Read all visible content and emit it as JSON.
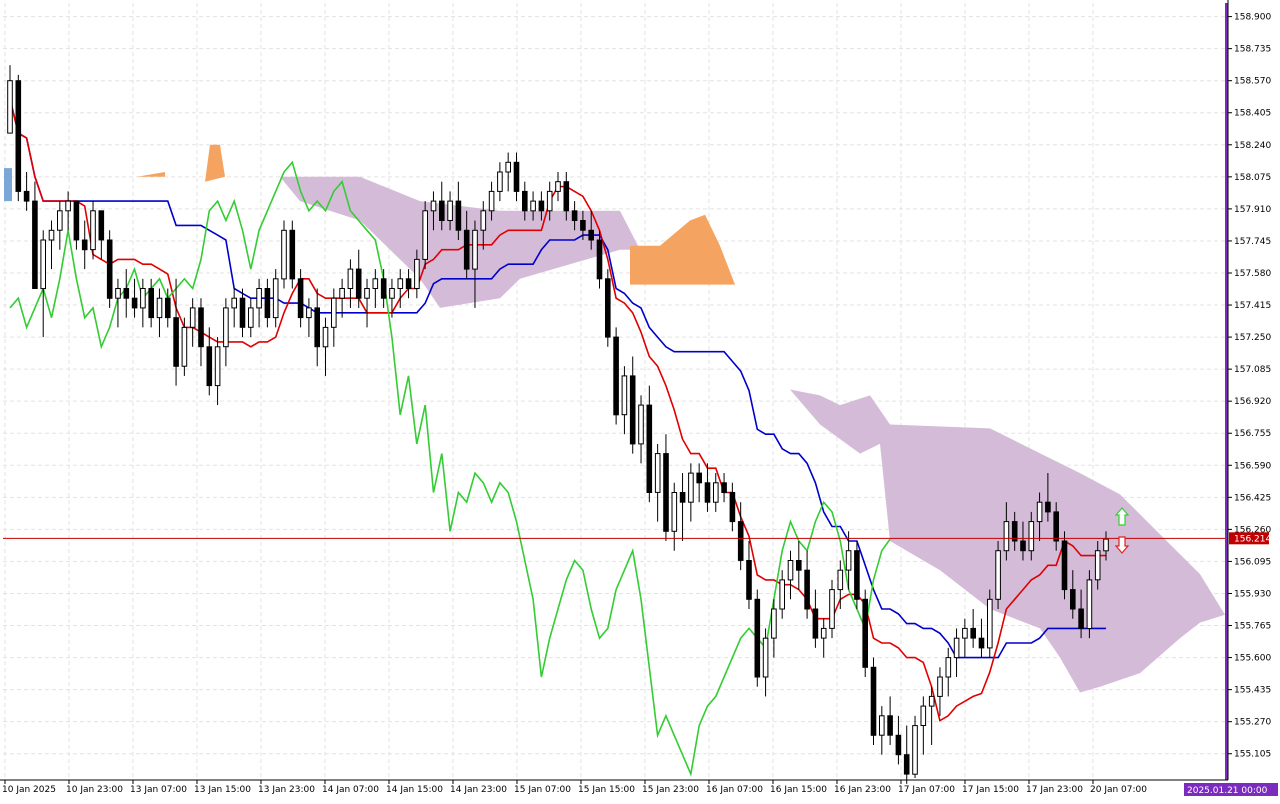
{
  "chart_data": {
    "type": "candlestick",
    "indicator": "Ichimoku",
    "y_axis": {
      "ylim": [
        154.98,
        158.97
      ],
      "ticks": [
        "158.900",
        "158.735",
        "158.570",
        "158.405",
        "158.240",
        "158.075",
        "157.910",
        "157.745",
        "157.580",
        "157.415",
        "157.250",
        "157.085",
        "156.920",
        "156.755",
        "156.590",
        "156.425",
        "156.260",
        "156.095",
        "155.930",
        "155.765",
        "155.600",
        "155.435",
        "155.270",
        "155.105"
      ]
    },
    "x_axis": {
      "ticks": [
        "10 Jan 2025",
        "10 Jan 23:00",
        "13 Jan 07:00",
        "13 Jan 15:00",
        "13 Jan 23:00",
        "14 Jan 07:00",
        "14 Jan 15:00",
        "14 Jan 23:00",
        "15 Jan 07:00",
        "15 Jan 15:00",
        "15 Jan 23:00",
        "16 Jan 07:00",
        "16 Jan 15:00",
        "16 Jan 23:00",
        "17 Jan 07:00",
        "17 Jan 15:00",
        "17 Jan 23:00",
        "20 Jan 07:00"
      ],
      "end_label": "2025.01.21 00:00"
    },
    "current_price": {
      "value": 156.214,
      "label": "156.214"
    },
    "grid": true,
    "colors": {
      "tenkan": "#e00000",
      "kijun": "#0000cc",
      "chikou": "#33cc33",
      "cloud_bear": "#d4bcd8",
      "cloud_bull": "#f4a460",
      "price_line": "#c00000",
      "axis_accent": "#7b2cbf",
      "grid": "#e3e3e3"
    },
    "candles": [
      [
        158.3,
        158.65,
        158.3,
        158.57
      ],
      [
        158.57,
        158.6,
        157.95,
        158.0
      ],
      [
        158.0,
        158.1,
        157.9,
        157.95
      ],
      [
        157.95,
        158.05,
        157.5,
        157.5
      ],
      [
        157.5,
        157.8,
        157.25,
        157.75
      ],
      [
        157.75,
        157.85,
        157.6,
        157.8
      ],
      [
        157.8,
        157.95,
        157.7,
        157.9
      ],
      [
        157.9,
        158.0,
        157.8,
        157.95
      ],
      [
        157.95,
        157.95,
        157.7,
        157.75
      ],
      [
        157.75,
        157.85,
        157.6,
        157.7
      ],
      [
        157.7,
        157.95,
        157.65,
        157.9
      ],
      [
        157.9,
        157.9,
        157.65,
        157.75
      ],
      [
        157.75,
        157.8,
        157.4,
        157.45
      ],
      [
        157.45,
        157.55,
        157.3,
        157.5
      ],
      [
        157.5,
        157.6,
        157.35,
        157.45
      ],
      [
        157.45,
        157.55,
        157.35,
        157.4
      ],
      [
        157.4,
        157.55,
        157.3,
        157.5
      ],
      [
        157.5,
        157.55,
        157.3,
        157.35
      ],
      [
        157.35,
        157.5,
        157.25,
        157.45
      ],
      [
        157.45,
        157.5,
        157.3,
        157.35
      ],
      [
        157.35,
        157.55,
        157.0,
        157.1
      ],
      [
        157.1,
        157.35,
        157.05,
        157.3
      ],
      [
        157.3,
        157.45,
        157.2,
        157.4
      ],
      [
        157.4,
        157.45,
        157.1,
        157.2
      ],
      [
        157.2,
        157.3,
        156.95,
        157.0
      ],
      [
        157.0,
        157.25,
        156.9,
        157.2
      ],
      [
        157.2,
        157.45,
        157.1,
        157.4
      ],
      [
        157.4,
        157.5,
        157.3,
        157.45
      ],
      [
        157.45,
        157.5,
        157.25,
        157.3
      ],
      [
        157.3,
        157.45,
        157.25,
        157.4
      ],
      [
        157.4,
        157.55,
        157.3,
        157.5
      ],
      [
        157.5,
        157.55,
        157.3,
        157.35
      ],
      [
        157.35,
        157.6,
        157.3,
        157.55
      ],
      [
        157.55,
        157.85,
        157.5,
        157.8
      ],
      [
        157.8,
        157.85,
        157.5,
        157.55
      ],
      [
        157.55,
        157.6,
        157.3,
        157.35
      ],
      [
        157.35,
        157.45,
        157.25,
        157.4
      ],
      [
        157.4,
        157.5,
        157.1,
        157.2
      ],
      [
        157.2,
        157.35,
        157.05,
        157.3
      ],
      [
        157.3,
        157.5,
        157.2,
        157.45
      ],
      [
        157.45,
        157.55,
        157.35,
        157.5
      ],
      [
        157.5,
        157.65,
        157.4,
        157.6
      ],
      [
        157.6,
        157.7,
        157.4,
        157.45
      ],
      [
        157.45,
        157.55,
        157.3,
        157.5
      ],
      [
        157.5,
        157.6,
        157.4,
        157.55
      ],
      [
        157.55,
        157.6,
        157.4,
        157.45
      ],
      [
        157.45,
        157.55,
        157.35,
        157.5
      ],
      [
        157.5,
        157.6,
        157.4,
        157.55
      ],
      [
        157.55,
        157.6,
        157.45,
        157.5
      ],
      [
        157.5,
        157.7,
        157.45,
        157.65
      ],
      [
        157.65,
        157.95,
        157.6,
        157.9
      ],
      [
        157.9,
        158.0,
        157.8,
        157.95
      ],
      [
        157.95,
        158.05,
        157.8,
        157.85
      ],
      [
        157.85,
        158.0,
        157.8,
        157.95
      ],
      [
        157.95,
        158.05,
        157.75,
        157.8
      ],
      [
        157.8,
        157.9,
        157.55,
        157.6
      ],
      [
        157.6,
        157.85,
        157.4,
        157.8
      ],
      [
        157.8,
        157.95,
        157.7,
        157.9
      ],
      [
        157.9,
        158.05,
        157.85,
        158.0
      ],
      [
        158.0,
        158.15,
        157.95,
        158.1
      ],
      [
        158.1,
        158.2,
        158.0,
        158.15
      ],
      [
        158.15,
        158.2,
        157.95,
        158.0
      ],
      [
        158.0,
        158.05,
        157.85,
        157.9
      ],
      [
        157.9,
        158.0,
        157.85,
        157.95
      ],
      [
        157.95,
        158.0,
        157.85,
        157.9
      ],
      [
        157.9,
        158.05,
        157.85,
        158.0
      ],
      [
        158.0,
        158.1,
        157.95,
        158.05
      ],
      [
        158.05,
        158.1,
        157.85,
        157.9
      ],
      [
        157.9,
        157.95,
        157.8,
        157.85
      ],
      [
        157.85,
        157.9,
        157.75,
        157.8
      ],
      [
        157.8,
        157.9,
        157.7,
        157.75
      ],
      [
        157.75,
        157.8,
        157.5,
        157.55
      ],
      [
        157.55,
        157.6,
        157.2,
        157.25
      ],
      [
        157.25,
        157.3,
        156.8,
        156.85
      ],
      [
        156.85,
        157.1,
        156.75,
        157.05
      ],
      [
        157.05,
        157.15,
        156.65,
        156.7
      ],
      [
        156.7,
        156.95,
        156.6,
        156.9
      ],
      [
        156.9,
        157.0,
        156.4,
        156.45
      ],
      [
        156.45,
        156.7,
        156.3,
        156.65
      ],
      [
        156.65,
        156.75,
        156.2,
        156.25
      ],
      [
        156.25,
        156.5,
        156.15,
        156.45
      ],
      [
        156.45,
        156.55,
        156.2,
        156.4
      ],
      [
        156.4,
        156.6,
        156.3,
        156.55
      ],
      [
        156.55,
        156.6,
        156.4,
        156.5
      ],
      [
        156.5,
        156.6,
        156.35,
        156.4
      ],
      [
        156.4,
        156.55,
        156.35,
        156.5
      ],
      [
        156.5,
        156.55,
        156.4,
        156.45
      ],
      [
        156.45,
        156.5,
        156.25,
        156.3
      ],
      [
        156.3,
        156.4,
        156.05,
        156.1
      ],
      [
        156.1,
        156.2,
        155.85,
        155.9
      ],
      [
        155.9,
        155.95,
        155.45,
        155.5
      ],
      [
        155.5,
        155.75,
        155.4,
        155.7
      ],
      [
        155.7,
        155.9,
        155.6,
        155.85
      ],
      [
        155.85,
        156.05,
        155.8,
        156.0
      ],
      [
        156.0,
        156.15,
        155.9,
        156.1
      ],
      [
        156.1,
        156.2,
        155.95,
        156.05
      ],
      [
        156.05,
        156.15,
        155.8,
        155.85
      ],
      [
        155.85,
        155.95,
        155.65,
        155.7
      ],
      [
        155.7,
        155.8,
        155.6,
        155.75
      ],
      [
        155.75,
        156.0,
        155.7,
        155.95
      ],
      [
        155.95,
        156.1,
        155.85,
        156.05
      ],
      [
        156.05,
        156.25,
        155.95,
        156.15
      ],
      [
        156.15,
        156.2,
        155.85,
        155.9
      ],
      [
        155.9,
        155.95,
        155.5,
        155.55
      ],
      [
        155.55,
        155.6,
        155.15,
        155.2
      ],
      [
        155.2,
        155.35,
        155.1,
        155.3
      ],
      [
        155.3,
        155.4,
        155.15,
        155.2
      ],
      [
        155.2,
        155.3,
        155.05,
        155.1
      ],
      [
        155.1,
        155.25,
        154.95,
        155.0
      ],
      [
        155.0,
        155.3,
        154.98,
        155.25
      ],
      [
        155.25,
        155.4,
        155.1,
        155.35
      ],
      [
        155.35,
        155.45,
        155.15,
        155.4
      ],
      [
        155.4,
        155.55,
        155.3,
        155.5
      ],
      [
        155.5,
        155.65,
        155.4,
        155.6
      ],
      [
        155.6,
        155.75,
        155.5,
        155.7
      ],
      [
        155.7,
        155.8,
        155.6,
        155.75
      ],
      [
        155.75,
        155.85,
        155.65,
        155.7
      ],
      [
        155.7,
        155.8,
        155.6,
        155.65
      ],
      [
        155.65,
        155.95,
        155.6,
        155.9
      ],
      [
        155.9,
        156.2,
        155.85,
        156.15
      ],
      [
        156.15,
        156.4,
        156.1,
        156.3
      ],
      [
        156.3,
        156.35,
        156.15,
        156.2
      ],
      [
        156.2,
        156.3,
        156.1,
        156.15
      ],
      [
        156.15,
        156.35,
        156.1,
        156.3
      ],
      [
        156.3,
        156.45,
        156.2,
        156.4
      ],
      [
        156.4,
        156.55,
        156.3,
        156.35
      ],
      [
        156.35,
        156.4,
        156.15,
        156.2
      ],
      [
        156.2,
        156.25,
        155.9,
        155.95
      ],
      [
        155.95,
        156.05,
        155.8,
        155.85
      ],
      [
        155.85,
        155.95,
        155.7,
        155.75
      ],
      [
        155.75,
        156.05,
        155.7,
        156.0
      ],
      [
        156.0,
        156.2,
        155.95,
        156.15
      ],
      [
        156.15,
        156.25,
        156.1,
        156.21
      ]
    ],
    "cloud_spans": [
      {
        "kind": "bear",
        "upper": [
          [
            8,
            158.075
          ],
          [
            140,
            158.075
          ],
          [
            165,
            158.075
          ],
          [
            200,
            158.075
          ],
          [
            280,
            158.075
          ],
          [
            360,
            158.075
          ],
          [
            420,
            157.95
          ],
          [
            500,
            157.9
          ],
          [
            620,
            157.9
          ],
          [
            640,
            157.7
          ],
          [
            720,
            157.6
          ],
          [
            740,
            157.48
          ],
          [
            780,
            157.4
          ],
          [
            790,
            156.98
          ],
          [
            820,
            156.95
          ],
          [
            840,
            156.9
          ],
          [
            870,
            156.95
          ],
          [
            890,
            156.8
          ],
          [
            990,
            156.78
          ],
          [
            1080,
            156.55
          ],
          [
            1120,
            156.44
          ],
          [
            1200,
            156.03
          ],
          [
            1225,
            155.82
          ]
        ],
        "lower": [
          [
            8,
            158.075
          ],
          [
            140,
            158.075
          ],
          [
            165,
            158.075
          ],
          [
            200,
            158.075
          ],
          [
            280,
            158.075
          ],
          [
            300,
            157.95
          ],
          [
            360,
            157.85
          ],
          [
            400,
            157.65
          ],
          [
            420,
            157.55
          ],
          [
            440,
            157.4
          ],
          [
            500,
            157.45
          ],
          [
            520,
            157.55
          ],
          [
            620,
            157.7
          ],
          [
            640,
            157.7
          ],
          [
            720,
            157.6
          ],
          [
            740,
            157.48
          ],
          [
            780,
            157.4
          ],
          [
            790,
            156.98
          ],
          [
            820,
            156.8
          ],
          [
            860,
            156.65
          ],
          [
            880,
            156.7
          ],
          [
            890,
            156.2
          ],
          [
            940,
            156.05
          ],
          [
            990,
            155.85
          ],
          [
            1040,
            155.75
          ],
          [
            1060,
            155.6
          ],
          [
            1080,
            155.42
          ],
          [
            1100,
            155.45
          ],
          [
            1140,
            155.52
          ],
          [
            1180,
            155.7
          ],
          [
            1200,
            155.78
          ],
          [
            1225,
            155.82
          ]
        ]
      }
    ]
  }
}
